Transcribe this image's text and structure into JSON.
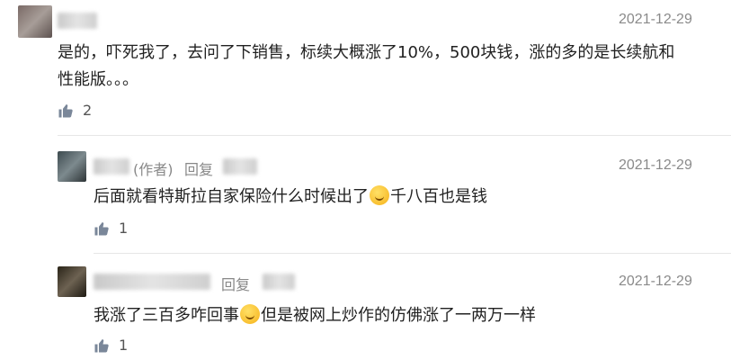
{
  "comments": [
    {
      "date": "2021-12-29",
      "text_line1": "是的，吓死我了，去问了下销售，标续大概涨了10%，500块钱，涨的多的是长续航和",
      "text_line2": "性能版。。。",
      "likes": "2"
    },
    {
      "author_tag": "(作者)",
      "reply_label": "回复",
      "date": "2021-12-29",
      "text_before": "后面就看特斯拉自家保险什么时候出了",
      "emoji": "laugh-cry-emoji",
      "text_after": "千八百也是钱",
      "likes": "1"
    },
    {
      "reply_label": "回复",
      "date": "2021-12-29",
      "text_before": "我涨了三百多咋回事",
      "emoji": "thinking-emoji",
      "text_after": "但是被网上炒作的仿佛涨了一两万一样",
      "likes": "1"
    }
  ],
  "colors": {
    "text": "#222222",
    "meta": "#8a8a8a",
    "icon": "#7a8799"
  }
}
